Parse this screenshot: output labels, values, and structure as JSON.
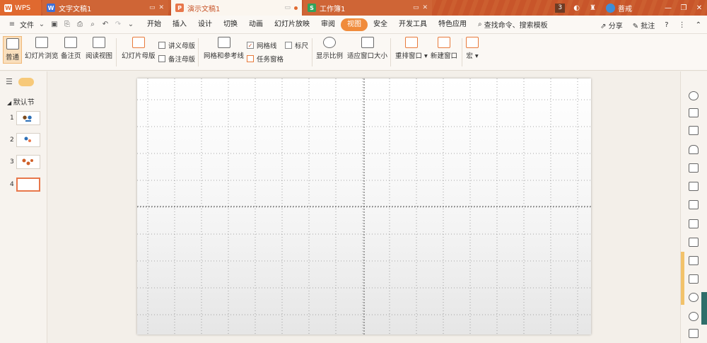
{
  "titlebar": {
    "app_name": "WPS",
    "tabs": [
      {
        "label": "文字文稿1",
        "icon": "W",
        "color": "#3e6fd8"
      },
      {
        "label": "演示文稿1",
        "icon": "P",
        "color": "#e8774b"
      },
      {
        "label": "工作簿1",
        "icon": "S",
        "color": "#33a35a"
      }
    ],
    "badge_count": "3",
    "user": "菩戒"
  },
  "menubar": {
    "file": "文件",
    "items": [
      "开始",
      "插入",
      "设计",
      "切换",
      "动画",
      "幻灯片放映",
      "审阅",
      "视图",
      "安全",
      "开发工具",
      "特色应用"
    ],
    "active": "视图",
    "search": "查找命令、搜索模板",
    "share": "分享",
    "comment": "批注"
  },
  "ribbon": {
    "normal": "普通",
    "slide_sorter": "幻灯片浏览",
    "notes_page": "备注页",
    "reading_view": "阅读视图",
    "slide_master": "幻灯片母版",
    "handout_master": "讲义母版",
    "notes_master": "备注母版",
    "grid_guides": "网格和参考线",
    "gridlines": "网格线",
    "ruler": "标尺",
    "task_pane": "任务窗格",
    "zoom": "显示比例",
    "fit_window": "适应窗口大小",
    "arrange": "重排窗口",
    "new_window": "新建窗口",
    "macro": "宏"
  },
  "leftpanel": {
    "section": "默认节",
    "slides": [
      {
        "num": "1"
      },
      {
        "num": "2"
      },
      {
        "num": "3"
      },
      {
        "num": "4"
      }
    ]
  },
  "colors": {
    "titlebar": "#c8552a",
    "accent": "#f08b3b",
    "selected_thumb": "#e8774b"
  }
}
